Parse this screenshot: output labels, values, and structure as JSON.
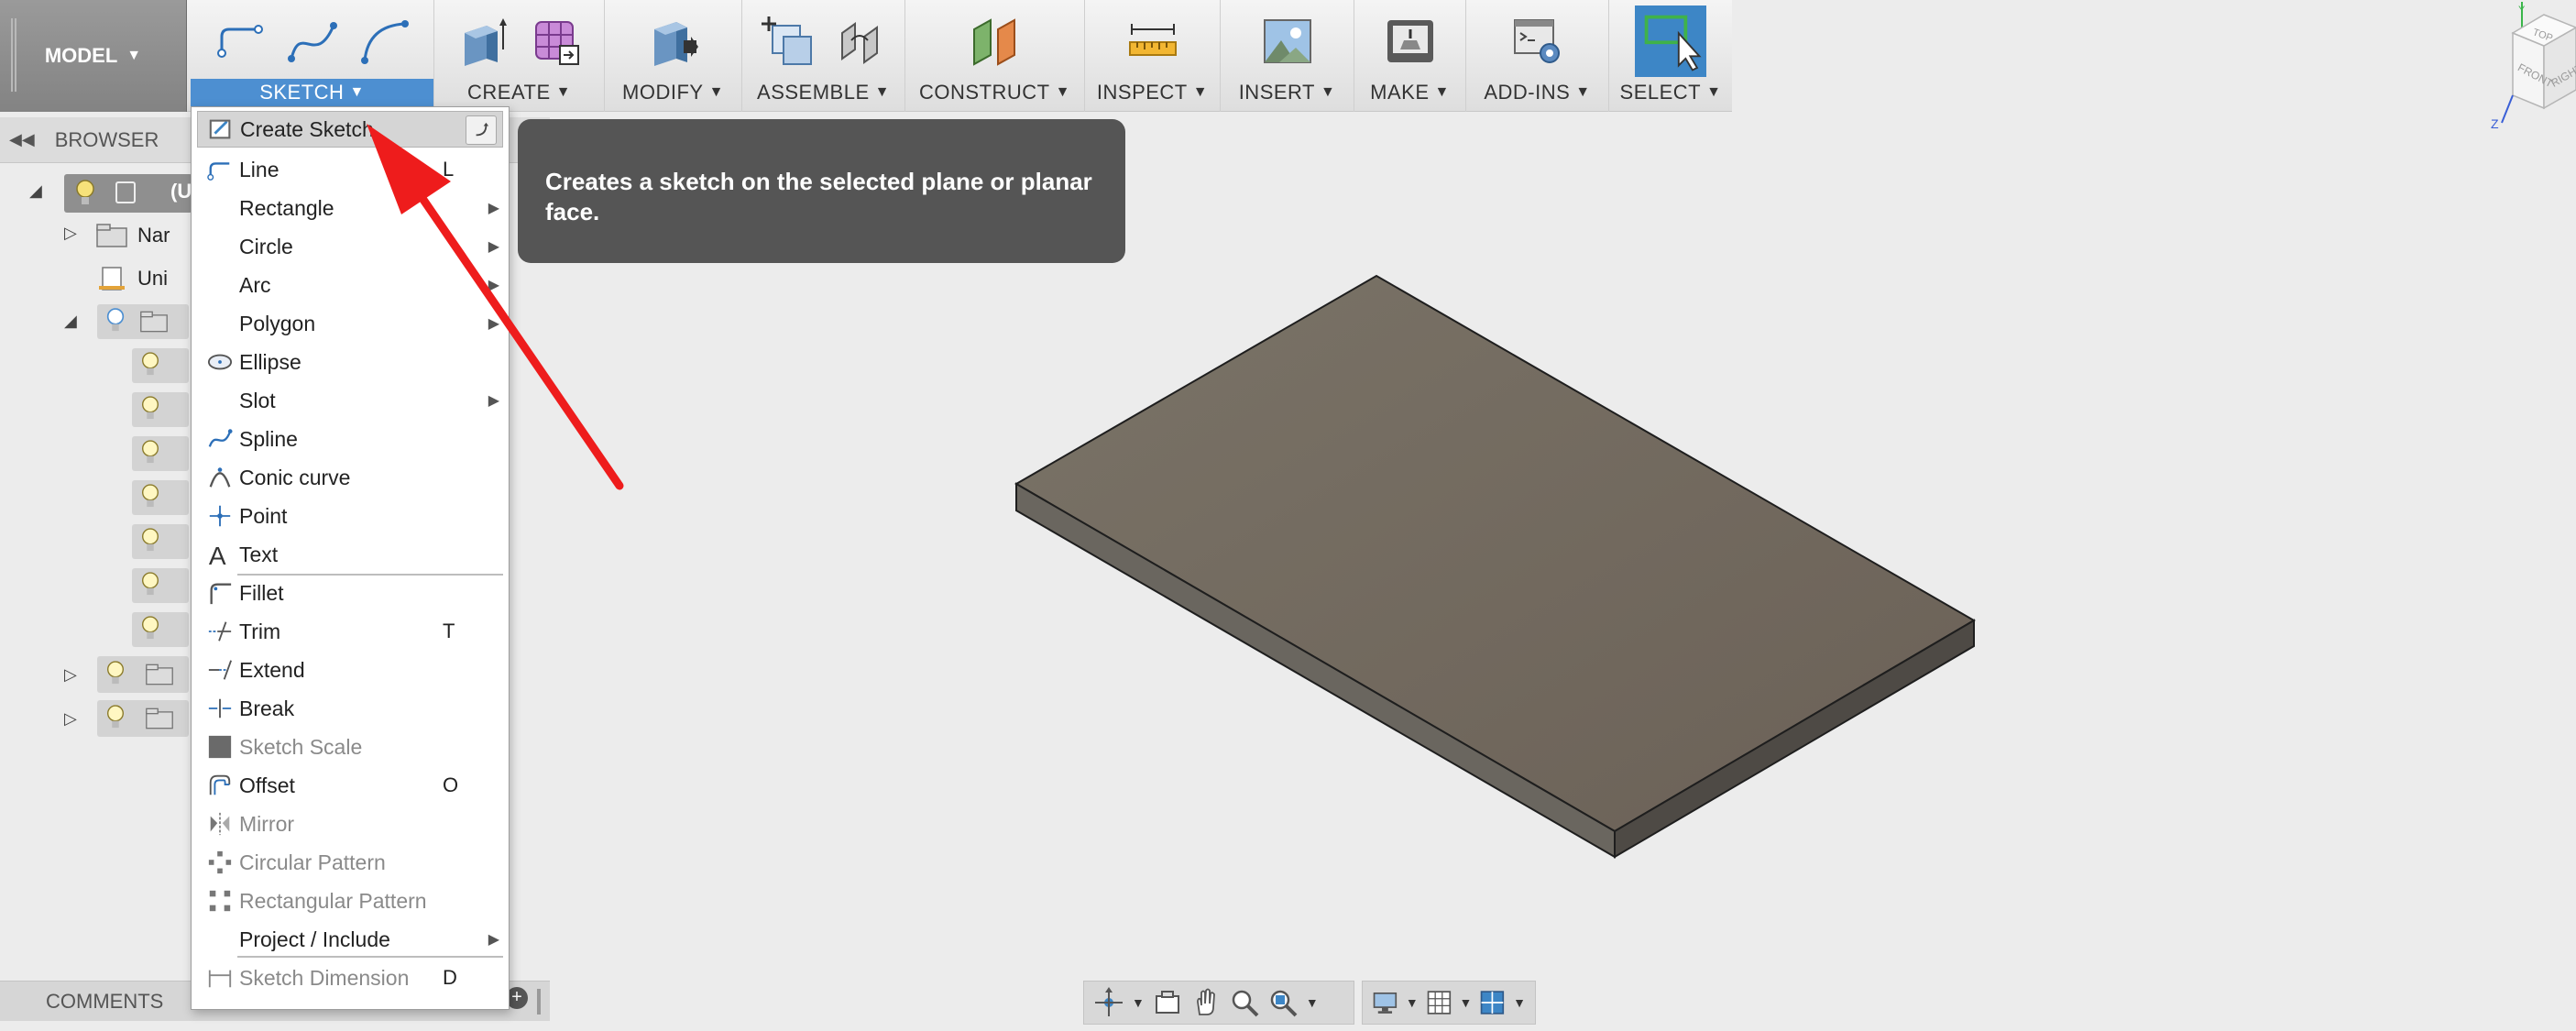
{
  "toolbar": {
    "workspace": "MODEL",
    "groups": {
      "sketch": "SKETCH",
      "create": "CREATE",
      "modify": "MODIFY",
      "assemble": "ASSEMBLE",
      "construct": "CONSTRUCT",
      "inspect": "INSPECT",
      "insert": "INSERT",
      "make": "MAKE",
      "addins": "ADD-INS",
      "select": "SELECT"
    }
  },
  "browser": {
    "title": "BROWSER",
    "root_label": "(U",
    "rows": [
      "Nar",
      "Uni"
    ]
  },
  "comments": {
    "label": "COMMENTS"
  },
  "sketch_menu": {
    "items": [
      {
        "label": "Create Sketch",
        "key": "",
        "submenu": false,
        "disabled": false,
        "icon": "create-sketch-icon"
      },
      {
        "label": "Line",
        "key": "L",
        "submenu": false,
        "disabled": false,
        "icon": "line-icon"
      },
      {
        "label": "Rectangle",
        "key": "",
        "submenu": true,
        "disabled": false,
        "icon": ""
      },
      {
        "label": "Circle",
        "key": "",
        "submenu": true,
        "disabled": false,
        "icon": ""
      },
      {
        "label": "Arc",
        "key": "",
        "submenu": true,
        "disabled": false,
        "icon": ""
      },
      {
        "label": "Polygon",
        "key": "",
        "submenu": true,
        "disabled": false,
        "icon": ""
      },
      {
        "label": "Ellipse",
        "key": "",
        "submenu": false,
        "disabled": false,
        "icon": "ellipse-icon"
      },
      {
        "label": "Slot",
        "key": "",
        "submenu": true,
        "disabled": false,
        "icon": ""
      },
      {
        "label": "Spline",
        "key": "",
        "submenu": false,
        "disabled": false,
        "icon": "spline-icon"
      },
      {
        "label": "Conic curve",
        "key": "",
        "submenu": false,
        "disabled": false,
        "icon": "conic-curve-icon"
      },
      {
        "label": "Point",
        "key": "",
        "submenu": false,
        "disabled": false,
        "icon": "point-icon"
      },
      {
        "label": "Text",
        "key": "",
        "submenu": false,
        "disabled": false,
        "icon": "text-icon"
      },
      {
        "label": "Fillet",
        "key": "",
        "submenu": false,
        "disabled": false,
        "icon": "fillet-icon"
      },
      {
        "label": "Trim",
        "key": "T",
        "submenu": false,
        "disabled": false,
        "icon": "trim-icon"
      },
      {
        "label": "Extend",
        "key": "",
        "submenu": false,
        "disabled": false,
        "icon": "extend-icon"
      },
      {
        "label": "Break",
        "key": "",
        "submenu": false,
        "disabled": false,
        "icon": "break-icon"
      },
      {
        "label": "Sketch Scale",
        "key": "",
        "submenu": false,
        "disabled": true,
        "icon": "sketch-scale-icon"
      },
      {
        "label": "Offset",
        "key": "O",
        "submenu": false,
        "disabled": false,
        "icon": "offset-icon"
      },
      {
        "label": "Mirror",
        "key": "",
        "submenu": false,
        "disabled": true,
        "icon": "mirror-icon"
      },
      {
        "label": "Circular Pattern",
        "key": "",
        "submenu": false,
        "disabled": true,
        "icon": "circular-pattern-icon"
      },
      {
        "label": "Rectangular Pattern",
        "key": "",
        "submenu": false,
        "disabled": true,
        "icon": "rectangular-pattern-icon"
      },
      {
        "label": "Project / Include",
        "key": "",
        "submenu": true,
        "disabled": false,
        "icon": ""
      },
      {
        "label": "Sketch Dimension",
        "key": "D",
        "submenu": false,
        "disabled": true,
        "icon": "sketch-dimension-icon"
      }
    ]
  },
  "tooltip": {
    "text": "Creates a sketch on the selected plane or planar face."
  },
  "viewcube": {
    "top": "TOP",
    "front": "FRONT",
    "right": "RIGHT",
    "axis_y": "Y",
    "axis_z": "Z"
  },
  "colors": {
    "accent": "#4d8fd1",
    "annotation_arrow": "#ee1c1c",
    "tooltip_bg": "#555555",
    "solid_top": "#726a5f",
    "solid_side": "#5c564e"
  }
}
